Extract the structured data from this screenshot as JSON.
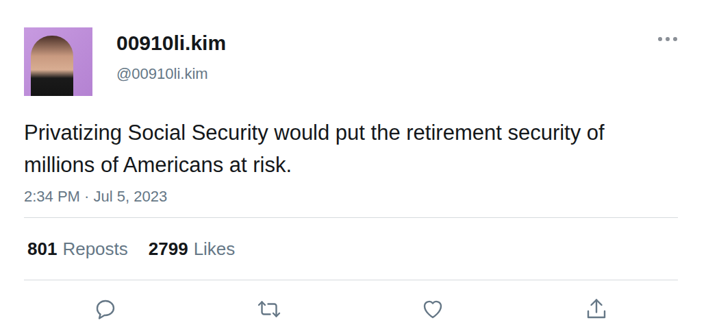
{
  "tweet": {
    "author": {
      "name": "00910li.kim",
      "handle": "@00910li.kim"
    },
    "text": "Privatizing Social Security would put the retirement security of millions of Americans at risk.",
    "timestamp": "2:34 PM · Jul 5, 2023",
    "stats": [
      {
        "count": "801",
        "label": "Reposts"
      },
      {
        "count": "2799",
        "label": "Likes"
      }
    ]
  }
}
